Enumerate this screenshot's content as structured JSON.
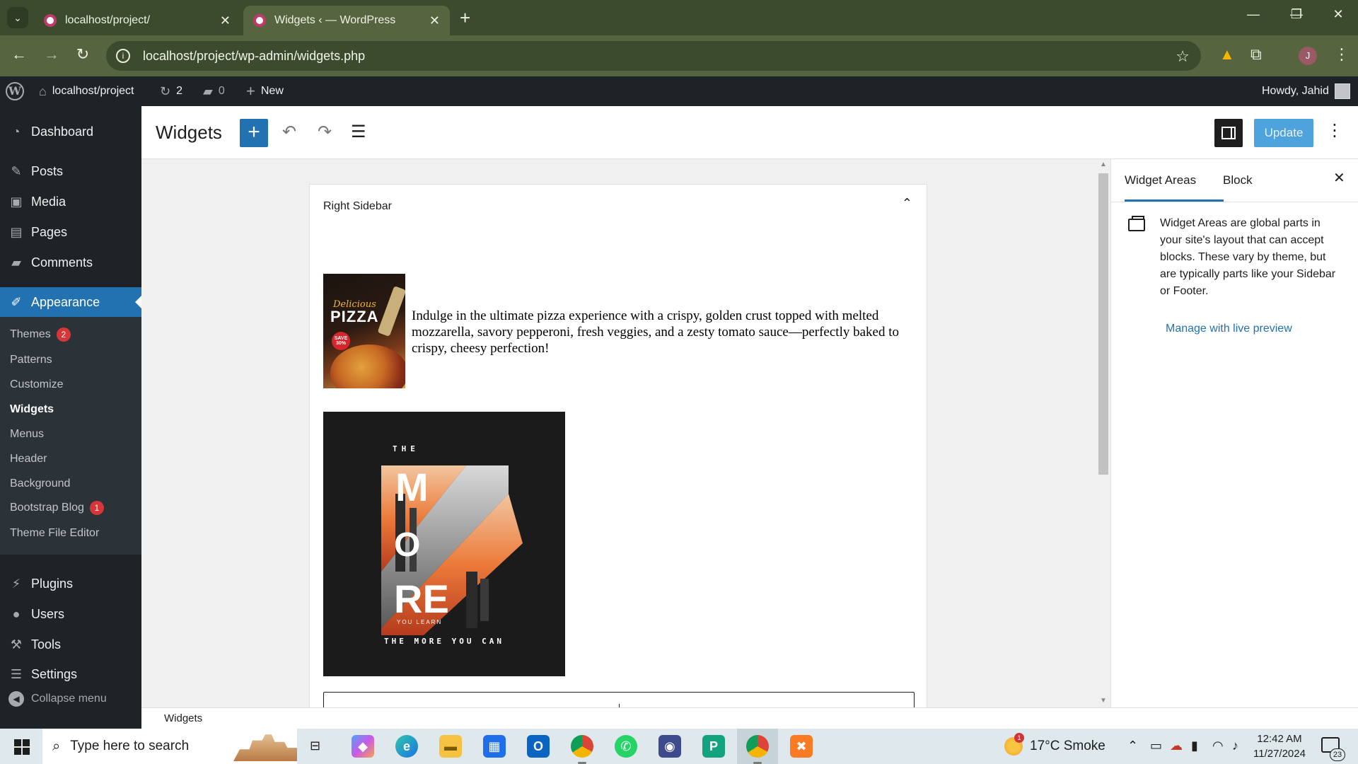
{
  "browser": {
    "tabs": [
      {
        "title": "localhost/project/"
      },
      {
        "title": "Widgets ‹ — WordPress"
      }
    ],
    "url": "localhost/project/wp-admin/widgets.php",
    "profile_initial": "J"
  },
  "adminbar": {
    "site_name": "localhost/project",
    "updates_count": "2",
    "comments_count": "0",
    "new_label": "New",
    "howdy": "Howdy, Jahid"
  },
  "menu": {
    "dashboard": "Dashboard",
    "posts": "Posts",
    "media": "Media",
    "pages": "Pages",
    "comments": "Comments",
    "appearance": "Appearance",
    "submenu": {
      "themes": "Themes",
      "themes_badge": "2",
      "patterns": "Patterns",
      "customize": "Customize",
      "widgets": "Widgets",
      "menus": "Menus",
      "header": "Header",
      "background": "Background",
      "bootstrap_blog": "Bootstrap Blog",
      "bootstrap_badge": "1",
      "theme_file_editor": "Theme File Editor"
    },
    "plugins": "Plugins",
    "users": "Users",
    "tools": "Tools",
    "settings": "Settings",
    "collapse": "Collapse menu"
  },
  "editor": {
    "title": "Widgets",
    "update_label": "Update",
    "widget_area_title": "Right Sidebar",
    "pizza_image": {
      "script": "Delicious",
      "word": "PIZZA",
      "sale": "SAVE 30%"
    },
    "pizza_text": "Indulge in the ultimate pizza experience with a crispy, golden crust topped with melted mozzarella, savory pepperoni, fresh veggies, and a zesty tomato sauce—perfectly baked to crispy, cheesy perfection!",
    "poster": {
      "top": "THE",
      "letters_m": "M",
      "letters_o": "O",
      "letters_re": "RE",
      "small": "YOU LEARN",
      "bottom": "THE MORE YOU CAN"
    },
    "footer_breadcrumb": "Widgets"
  },
  "sidepanel": {
    "tab_widget_areas": "Widget Areas",
    "tab_block": "Block",
    "description": "Widget Areas are global parts in your site's layout that can accept blocks. These vary by theme, but are typically parts like your Sidebar or Footer.",
    "link": "Manage with live preview"
  },
  "taskbar": {
    "search_placeholder": "Type here to search",
    "weather_badge": "1",
    "weather": "17°C  Smoke",
    "time": "12:42 AM",
    "date": "11/27/2024",
    "notifications": "23"
  },
  "colors": {
    "wp_blue": "#2271b1",
    "admin_dark": "#1d2327",
    "chrome_green": "#56643f",
    "badge_red": "#d63638"
  }
}
